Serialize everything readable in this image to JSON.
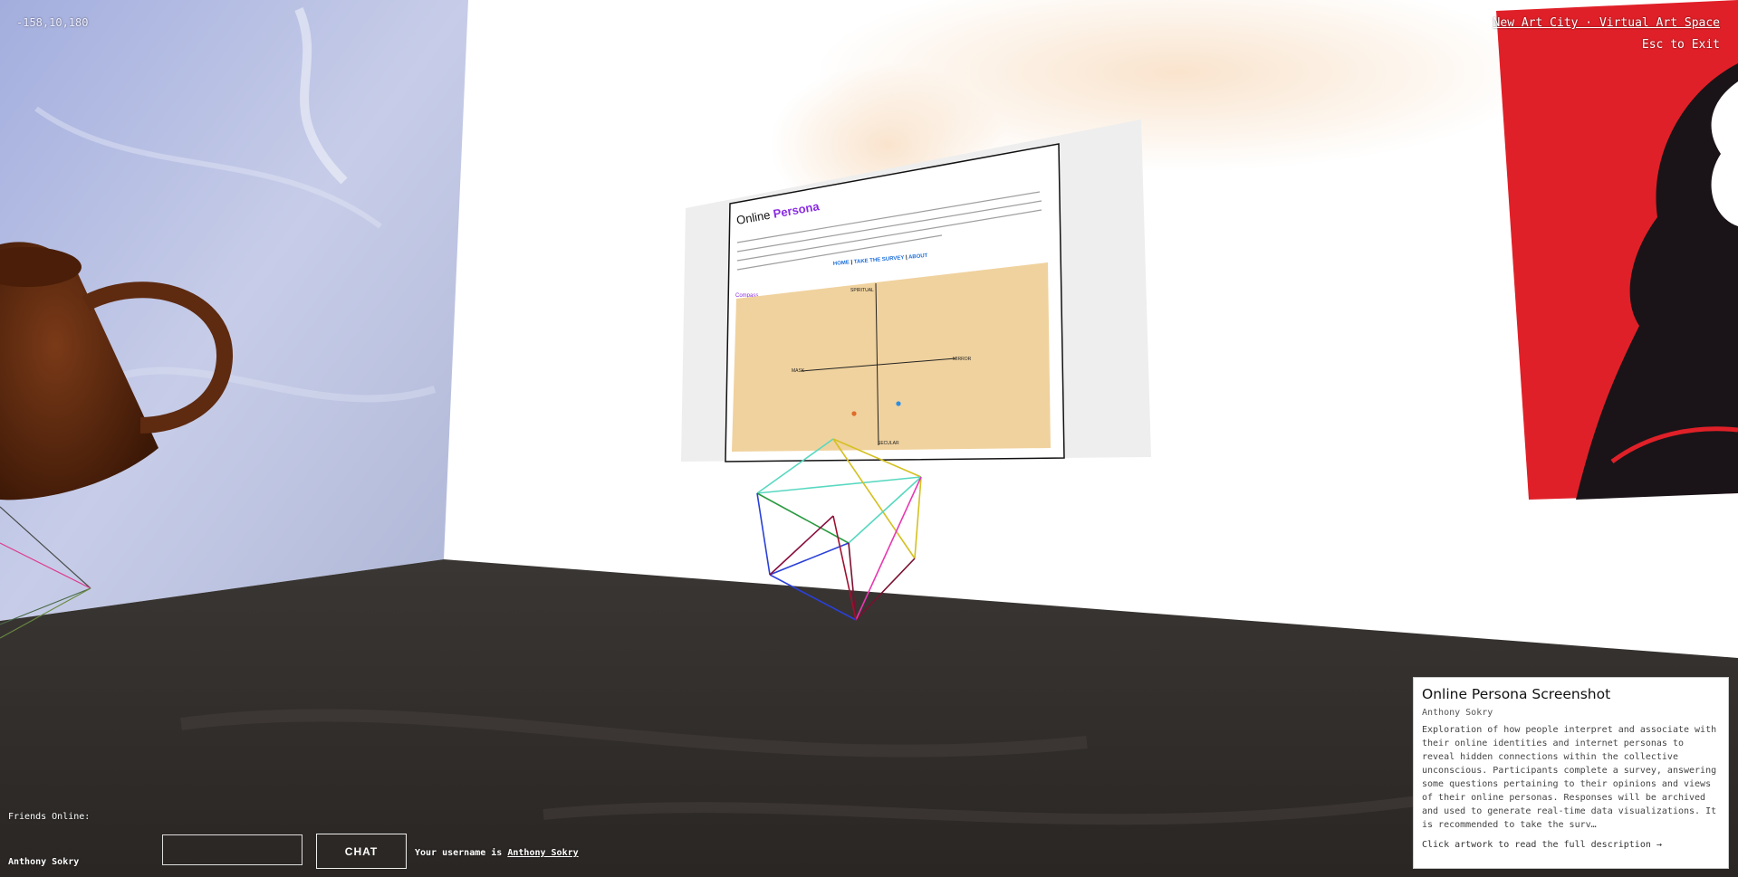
{
  "hud": {
    "coordinates": "-158,10,180",
    "app_title": "New Art City · Virtual Art Space",
    "exit_hint": "Esc to Exit"
  },
  "artwork_screen": {
    "title_plain": "Online",
    "title_accent": "Persona",
    "nav": [
      "HOME",
      "|",
      "TAKE THE SURVEY",
      "|",
      "ABOUT"
    ],
    "section_label": "Compass",
    "axis_top": "SPIRITUAL",
    "axis_bottom": "SECULAR",
    "axis_left": "MASK",
    "axis_right": "MIRROR",
    "colors": {
      "accent": "#8a2be2",
      "link": "#1e6fd9",
      "chart_bg": "#f0d29e",
      "dot_orange": "#e06a2b",
      "dot_blue": "#2b8fe0"
    }
  },
  "chat": {
    "friends_label": "Friends Online:",
    "friends": [
      "Anthony Sokry"
    ],
    "input_value": "",
    "input_placeholder": "",
    "button_label": "CHAT",
    "username_prefix": "Your username is",
    "username": "Anthony Sokry"
  },
  "info_card": {
    "title": "Online Persona Screenshot",
    "author": "Anthony Sokry",
    "description": "Exploration of how people interpret and associate with their online identities and internet personas to reveal hidden connections within the collective unconscious. Participants complete a survey, answering some questions pertaining to their opinions and views of their online personas. Responses will be archived and used to generate real-time data visualizations. It is recommended to take the surv…",
    "cta": "Click artwork to read the full description →"
  },
  "colors": {
    "floor": "#2f2b29",
    "wall": "#ffffff",
    "sky_wall": "#aab4d8",
    "red_art": "#e02028",
    "cup": "#5a2a12"
  }
}
